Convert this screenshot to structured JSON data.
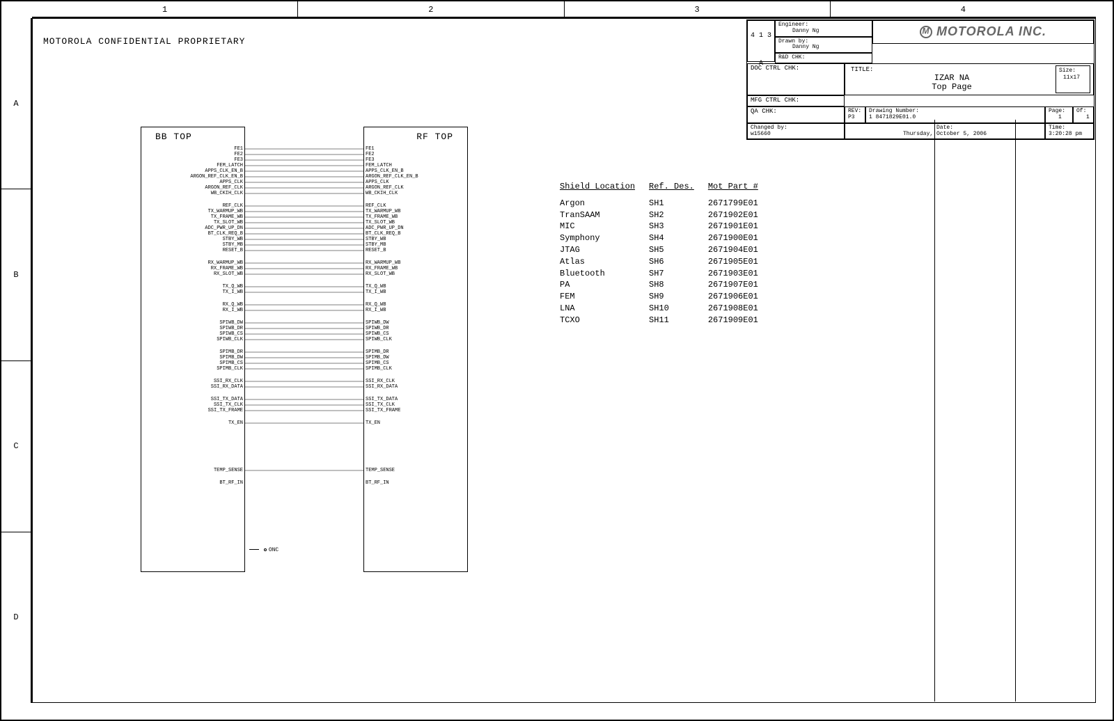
{
  "confidential": "MOTOROLA CONFIDENTIAL PROPRIETARY",
  "columns": [
    "1",
    "2",
    "3",
    "4"
  ],
  "rows": [
    "A",
    "B",
    "C",
    "D"
  ],
  "title_block": {
    "side_code": "4 1 3 A",
    "engineer_label": "Engineer:",
    "engineer": "Danny Ng",
    "drawn_label": "Drawn by:",
    "drawn": "Danny Ng",
    "rd_chk": "R&D CHK:",
    "doc_ctrl_chk": "DOC CTRL CHK:",
    "mfg_ctrl_chk": "MFG CTRL CHK:",
    "qa_chk": "QA CHK:",
    "changed_label": "Changed by:",
    "changed": "w15660",
    "company": "MOTOROLA INC.",
    "title_label": "TITLE:",
    "title1": "IZAR NA",
    "title2": "Top Page",
    "size_label": "Size:",
    "size": "11x17",
    "rev_label": "REV:",
    "rev": "P3",
    "drawing_no_label": "Drawing Number:",
    "drawing_no": "1 8471829E01.0",
    "page_label": "Page:",
    "page": "1",
    "of_label": "Of:",
    "of": "1",
    "date_label": "Date:",
    "date": "Thursday, October 5, 2006",
    "time_label": "Time:",
    "time": "3:20:28 pm"
  },
  "blocks": {
    "bb_title": "BB TOP",
    "rf_title": "RF TOP"
  },
  "signals": [
    "FE1",
    "FE2",
    "FE3",
    "FEM_LATCH",
    "APPS_CLK_EN_B",
    "ARGON_REF_CLK_EN_B",
    "APPS_CLK",
    "ARGON_REF_CLK",
    "WB_CKIH_CLK",
    "",
    "REF_CLK",
    "TX_WARMUP_WB",
    "TX_FRAME_WB",
    "TX_SLOT_WB",
    "ADC_PWR_UP_DN",
    "BT_CLK_REQ_B",
    "STBY_WB",
    "STBY_MB",
    "RESET_B",
    "",
    "RX_WARMUP_WB",
    "RX_FRAME_WB",
    "RX_SLOT_WB",
    "",
    "TX_Q_WB",
    "TX_I_WB",
    "",
    "RX_Q_WB",
    "RX_I_WB",
    "",
    "SPIWB_DW",
    "SPIWB_DR",
    "SPIWB_CS",
    "SPIWB_CLK",
    "",
    "SPIMB_DR",
    "SPIMB_DW",
    "SPIMB_CS",
    "SPIMB_CLK",
    "",
    "SSI_RX_CLK",
    "SSI_RX_DATA",
    "",
    "SSI_TX_DATA",
    "SSI_TX_CLK",
    "SSI_TX_FRAME",
    "",
    "TX_EN",
    "",
    "",
    "",
    "",
    "",
    "",
    "TEMP_SENSE",
    "",
    "BT_RF_IN"
  ],
  "onc_label": "ONC",
  "shield": {
    "headers": [
      "Shield Location",
      "Ref. Des.",
      "Mot Part #"
    ],
    "rows": [
      [
        "Argon",
        "SH1",
        "2671799E01"
      ],
      [
        "TranSAAM",
        "SH2",
        "2671902E01"
      ],
      [
        "MIC",
        "SH3",
        "2671901E01"
      ],
      [
        "Symphony",
        "SH4",
        "2671900E01"
      ],
      [
        "JTAG",
        "SH5",
        "2671904E01"
      ],
      [
        "Atlas",
        "SH6",
        "2671905E01"
      ],
      [
        "Bluetooth",
        "SH7",
        "2671903E01"
      ],
      [
        "PA",
        "SH8",
        "2671907E01"
      ],
      [
        "FEM",
        "SH9",
        "2671906E01"
      ],
      [
        "LNA",
        "SH10",
        "2671908E01"
      ],
      [
        "TCXO",
        "SH11",
        "2671909E01"
      ]
    ]
  }
}
